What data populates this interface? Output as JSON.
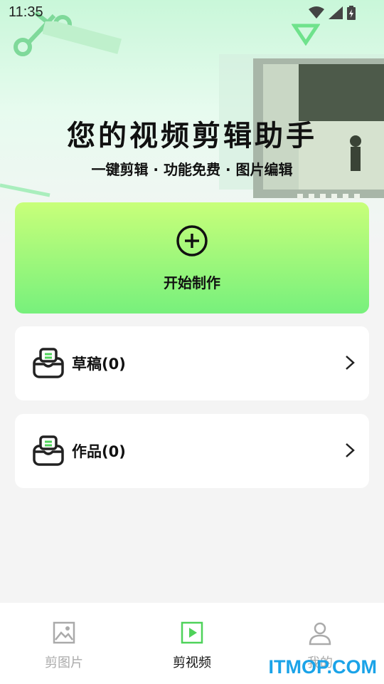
{
  "status_bar": {
    "time": "11:35",
    "icons": [
      "wifi-icon",
      "cellular-signal-icon",
      "battery-icon"
    ]
  },
  "hero": {
    "title": "您的视频剪辑助手",
    "subtitle": "一键剪辑 · 功能免费 · 图片编辑"
  },
  "create": {
    "label": "开始制作",
    "icon": "plus-circle-icon"
  },
  "lists": [
    {
      "label": "草稿(0)",
      "icon": "inbox-icon"
    },
    {
      "label": "作品(0)",
      "icon": "inbox-icon"
    }
  ],
  "tabbar": {
    "tabs": [
      {
        "label": "剪图片",
        "icon": "image-icon",
        "active": false
      },
      {
        "label": "剪视频",
        "icon": "video-icon",
        "active": true
      },
      {
        "label": "我的",
        "icon": "user-icon",
        "active": false
      }
    ]
  },
  "watermark": "ITMOP.COM",
  "colors": {
    "accent_green": "#4fd25a",
    "card_gradient_top": "#c8ff7a",
    "card_gradient_bottom": "#77f07c",
    "watermark_blue": "#1aa3e8"
  }
}
